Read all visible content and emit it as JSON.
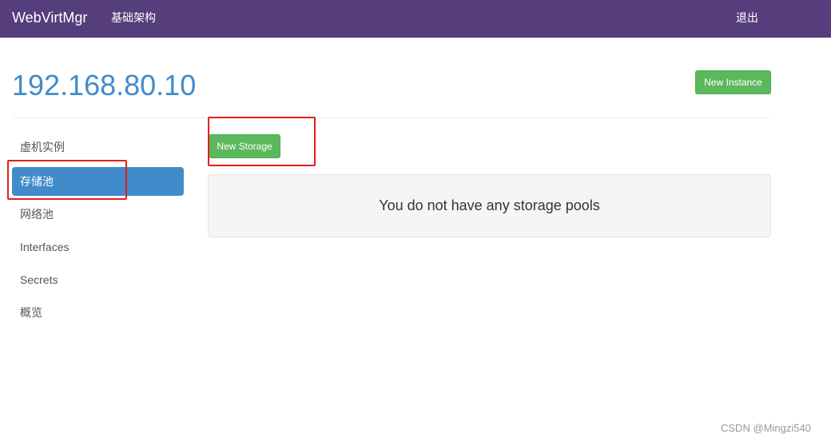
{
  "navbar": {
    "brand": "WebVirtMgr",
    "infrastructure": "基础架构",
    "logout": "退出"
  },
  "host": {
    "title": "192.168.80.10",
    "new_instance_label": "New Instance"
  },
  "sidebar": {
    "items": [
      {
        "label": "虚机实例"
      },
      {
        "label": "存储池",
        "active": true
      },
      {
        "label": "网络池"
      },
      {
        "label": "Interfaces"
      },
      {
        "label": "Secrets"
      },
      {
        "label": "概览"
      }
    ]
  },
  "storage": {
    "new_storage_label": "New Storage",
    "empty_message": "You do not have any storage pools"
  },
  "colors": {
    "navbar": "#563d7c",
    "accent": "#428bca",
    "success": "#5cb85c",
    "annotation": "#e0201c"
  },
  "watermark": "CSDN @Mingzi540"
}
